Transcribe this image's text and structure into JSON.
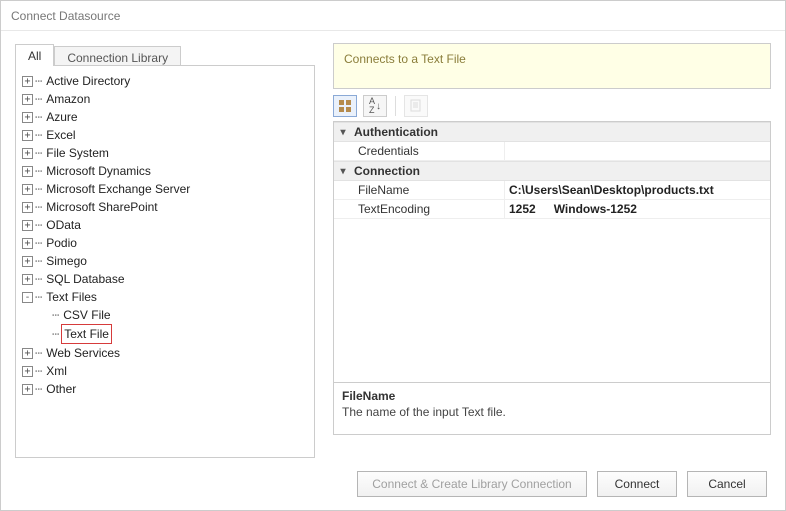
{
  "window": {
    "title": "Connect Datasource"
  },
  "tabs": {
    "all": "All",
    "lib": "Connection Library"
  },
  "tree": {
    "items": [
      "Active Directory",
      "Amazon",
      "Azure",
      "Excel",
      "File System",
      "Microsoft Dynamics",
      "Microsoft Exchange Server",
      "Microsoft SharePoint",
      "OData",
      "Podio",
      "Simego",
      "SQL Database"
    ],
    "textfiles": {
      "label": "Text Files",
      "children": [
        "CSV File",
        "Text File"
      ]
    },
    "tail": [
      "Web Services",
      "Xml",
      "Other"
    ]
  },
  "banner": "Connects to a Text File",
  "toolbar": {
    "cat": "categorized-icon",
    "sort": "A↓Z",
    "page": "pages-icon"
  },
  "grid": {
    "auth": {
      "header": "Authentication",
      "credentials_k": "Credentials",
      "credentials_v": ""
    },
    "conn": {
      "header": "Connection",
      "filename_k": "FileName",
      "filename_v": "C:\\Users\\Sean\\Desktop\\products.txt",
      "enc_k": "TextEncoding",
      "enc_v1": "1252",
      "enc_v2": "Windows-1252"
    }
  },
  "desc": {
    "title": "FileName",
    "body": "The name of the input Text file."
  },
  "buttons": {
    "createlib": "Connect & Create Library Connection",
    "connect": "Connect",
    "cancel": "Cancel"
  }
}
